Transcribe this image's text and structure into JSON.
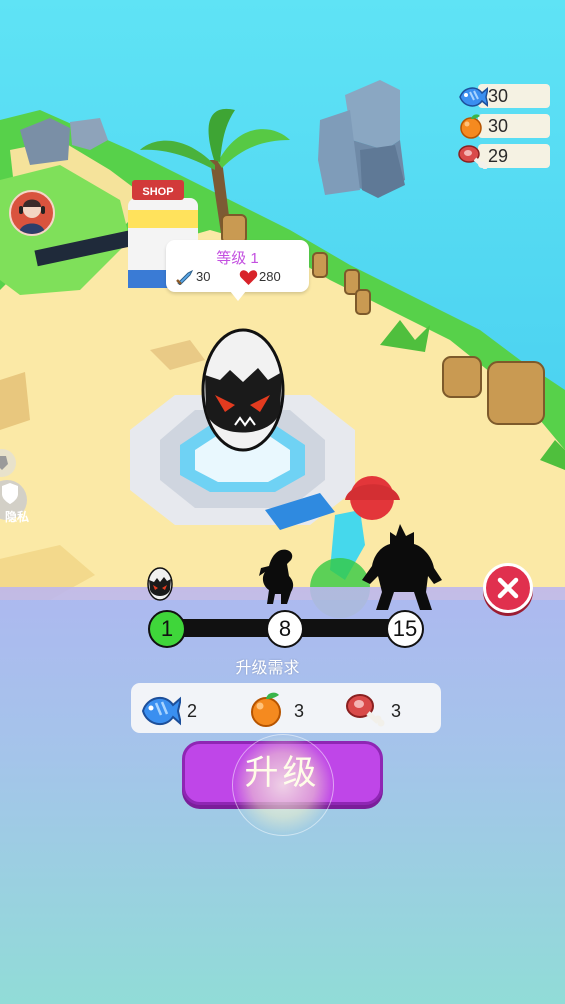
{
  "resources": [
    {
      "icon": "fish-icon",
      "value": "30"
    },
    {
      "icon": "orange-icon",
      "value": "30"
    },
    {
      "icon": "meat-icon",
      "value": "29"
    }
  ],
  "scene": {
    "shop_sign": "SHOP",
    "privacy_label": "隐私"
  },
  "bubble": {
    "level": "等级 1",
    "attack": "30",
    "hp": "280"
  },
  "progress": {
    "stages": [
      "1",
      "8",
      "15"
    ],
    "current_stage": "1"
  },
  "requirements": {
    "title": "升级需求",
    "items": [
      {
        "icon": "fish-icon",
        "count": "2"
      },
      {
        "icon": "orange-icon",
        "count": "3"
      },
      {
        "icon": "meat-icon",
        "count": "3"
      }
    ]
  },
  "upgrade_label": "升级",
  "colors": {
    "upgrade_button": "#bf46e8",
    "close_button": "#e0304e",
    "current_stage": "#3fd63a",
    "level_text": "#c34fe0"
  }
}
